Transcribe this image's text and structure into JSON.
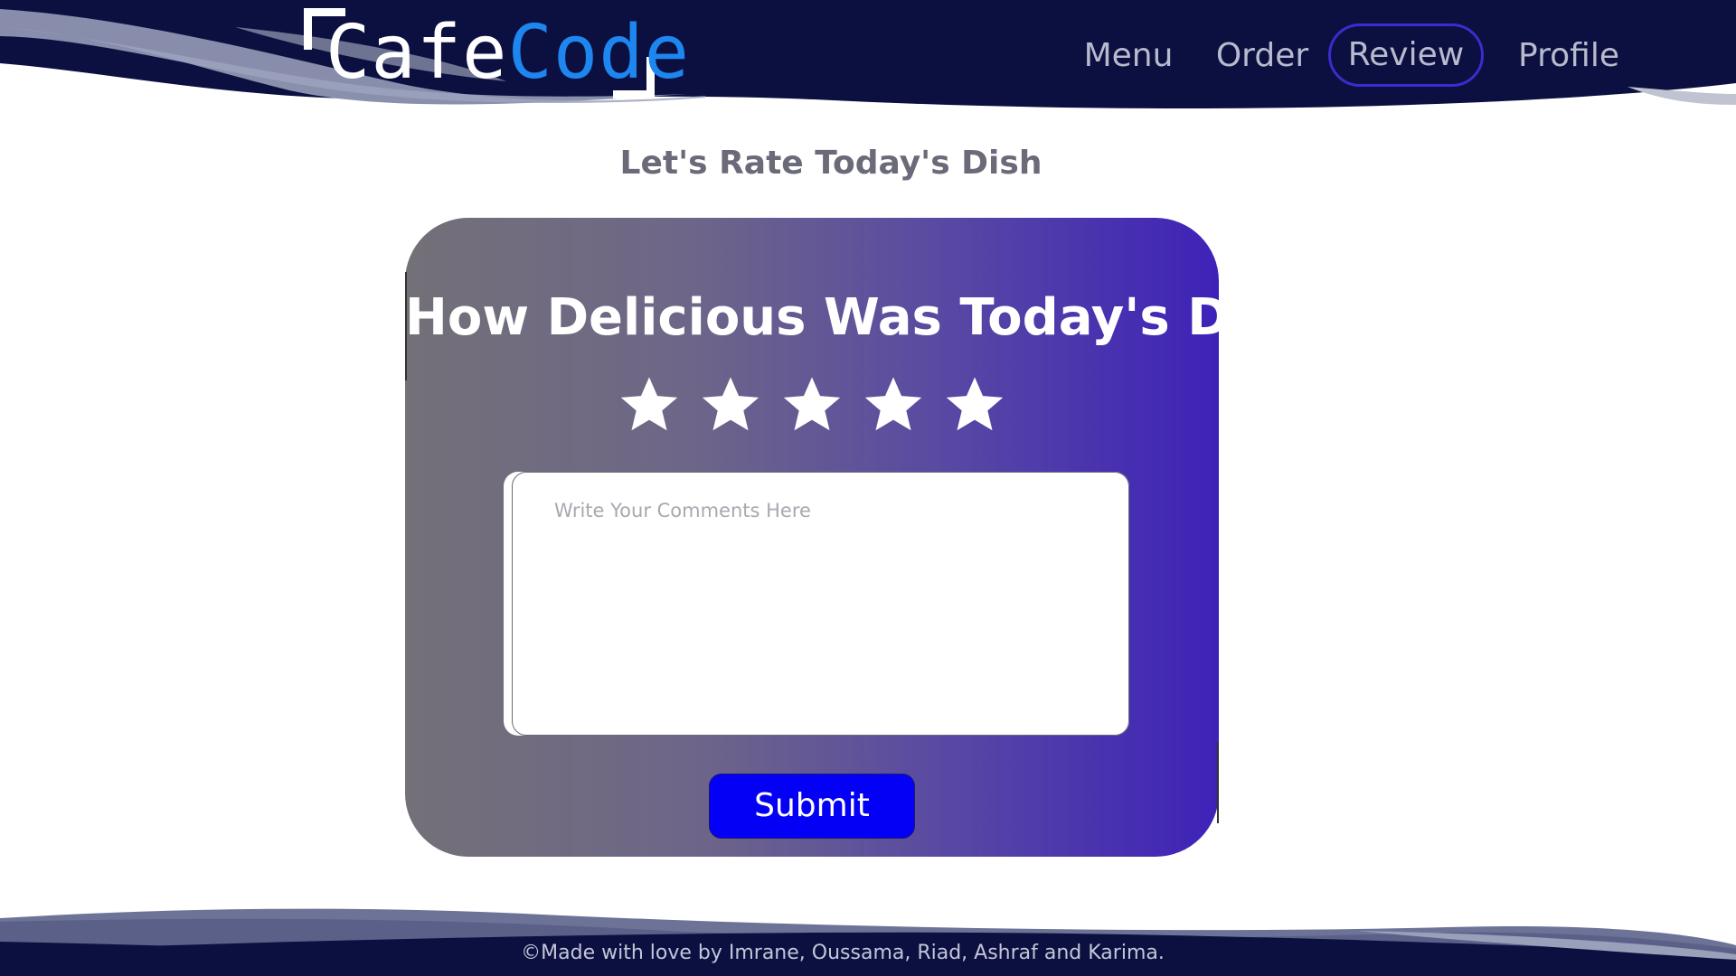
{
  "brand": {
    "part1": "Cafe",
    "part2": "Code"
  },
  "nav": {
    "menu": "Menu",
    "order": "Order",
    "review": "Review",
    "profile": "Profile"
  },
  "page_title": "Let's Rate Today's Dish",
  "card": {
    "heading": "How Delicious Was Today's Dish",
    "stars_total": 5,
    "comment_placeholder": "Write Your Comments Here",
    "submit_label": "Submit"
  },
  "footer": {
    "text": "©Made with love by Imrane, Oussama, Riad, Ashraf and Karima."
  },
  "colors": {
    "header_navy": "#0b1040",
    "logo_accent": "#1e86ef",
    "active_nav_border": "#3d2bcf",
    "submit_blue": "#0400f5"
  }
}
